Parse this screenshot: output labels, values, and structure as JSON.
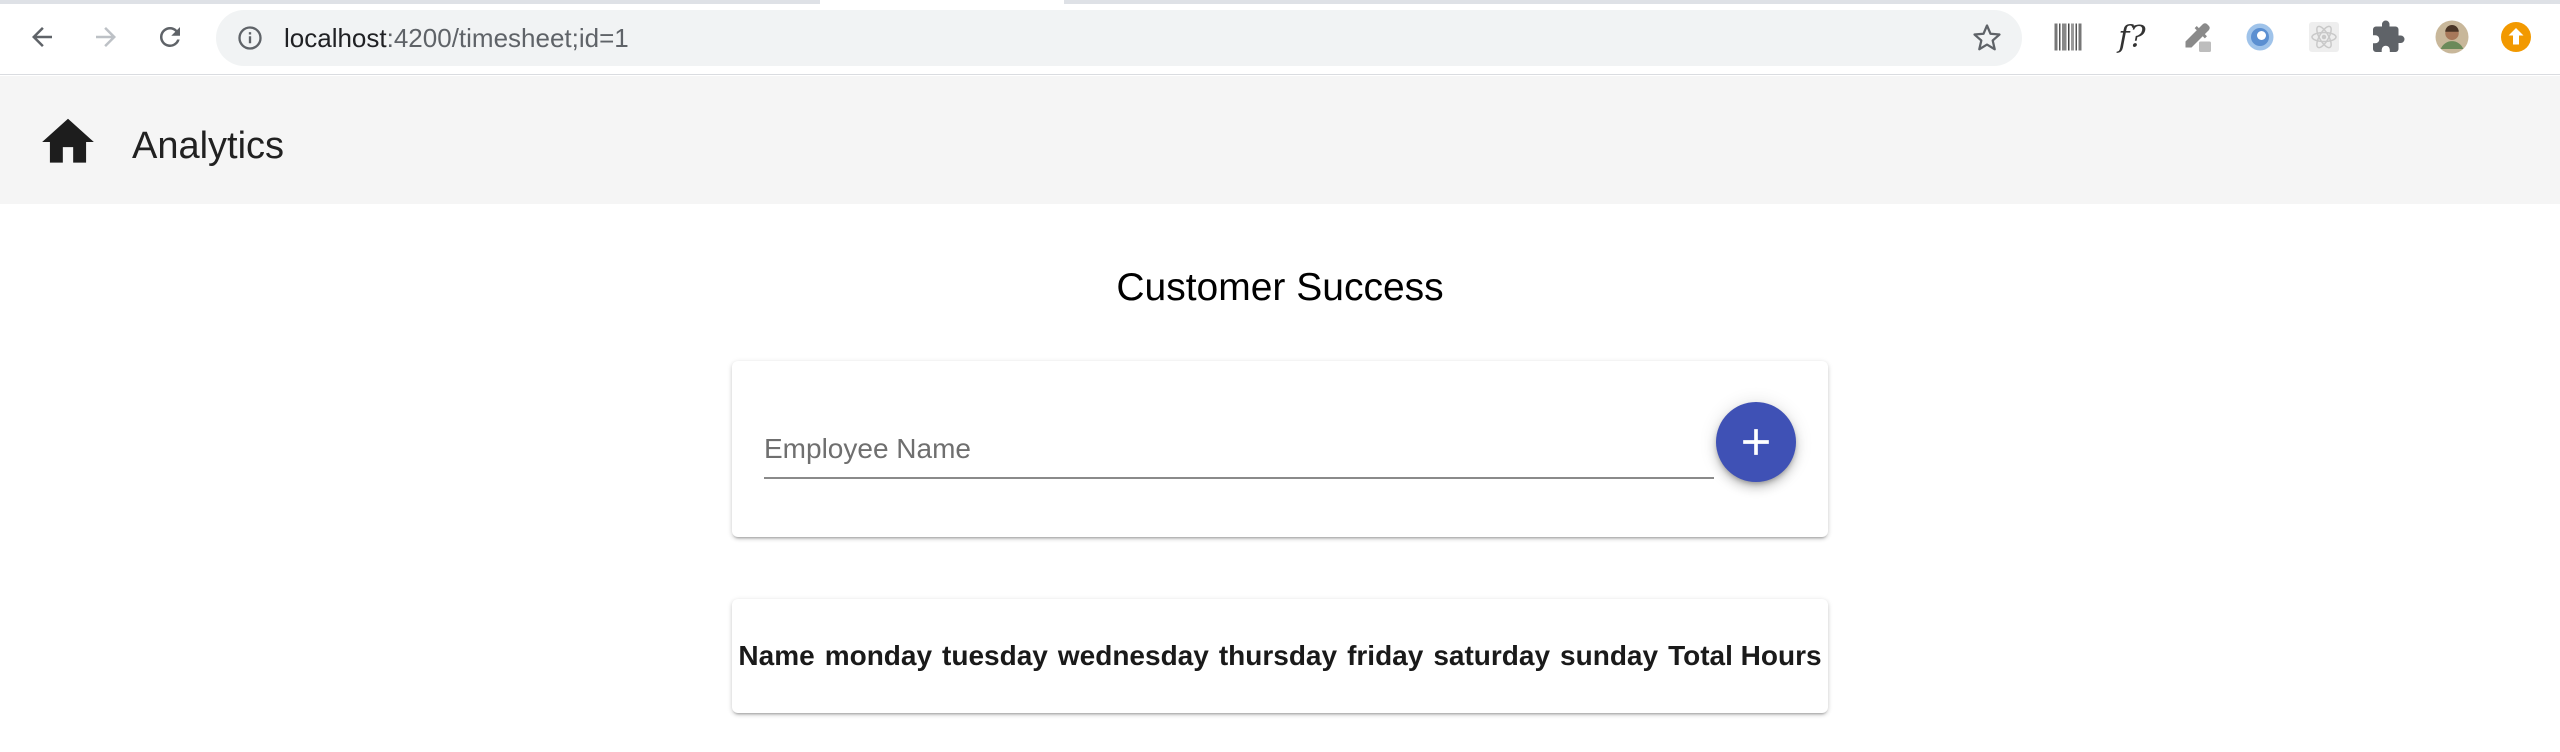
{
  "browser": {
    "url_host": "localhost",
    "url_path": ":4200/timesheet;id=1",
    "extensions": [
      "barcode-icon",
      "f-question-icon",
      "eyedropper-icon",
      "blue-orb-icon",
      "react-icon",
      "puzzle-icon",
      "avatar",
      "update-icon"
    ],
    "ext_fx_label": "f?"
  },
  "toolbar": {
    "title": "Analytics"
  },
  "main": {
    "title": "Customer Success",
    "employee_input": {
      "placeholder": "Employee Name",
      "value": ""
    },
    "table": {
      "columns": [
        "Name",
        "monday",
        "tuesday",
        "wednesday",
        "thursday",
        "friday",
        "saturday",
        "sunday",
        "Total Hours"
      ]
    }
  },
  "colors": {
    "accent": "#3f51b5",
    "toolbar_bg": "#f5f5f5",
    "update_badge": "#f29900"
  }
}
